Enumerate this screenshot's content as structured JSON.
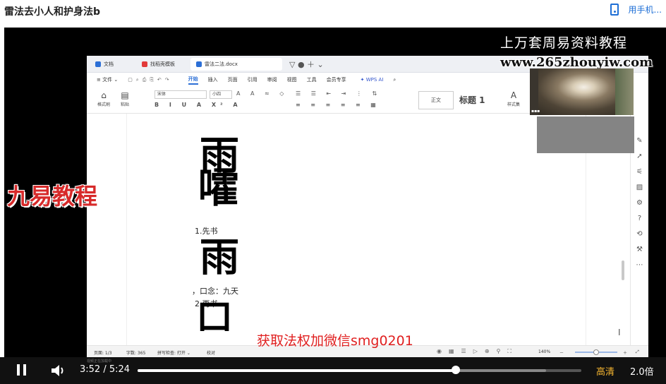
{
  "page": {
    "title": "雷法去小人和护身法b",
    "mobile_link": "用手机..."
  },
  "watermarks": {
    "top": "上万套周易资料教程",
    "url": "www.265zhouyiw.com",
    "left": "九易教程",
    "banner": "获取法权加微信smg0201"
  },
  "wps": {
    "tabs": [
      {
        "label": "文档",
        "icon_color": "#2c6fd6"
      },
      {
        "label": "找稻壳模板",
        "icon_color": "#e23a3a"
      },
      {
        "label": "雷法二法.docx",
        "icon_color": "#2c6fd6"
      }
    ],
    "tab_extra": "▽ ● ＋ ⌄",
    "menu_label": "≡ 文件 ⌄",
    "ribbon_tabs": [
      "开始",
      "插入",
      "页面",
      "引用",
      "审阅",
      "视图",
      "工具",
      "会员专享"
    ],
    "ribbon_active": "开始",
    "wps_ai": "WPS AI",
    "toolbar": {
      "format_painter": "格式刷",
      "paste": "粘贴",
      "font": "宋体",
      "size": "小四",
      "style_normal": "正文",
      "style_heading": "标题 1",
      "style_set": "样式集"
    },
    "document": {
      "glyph1": "雨",
      "glyph2": "嚯",
      "step1": "1.先书",
      "glyph3": "雨",
      "note": "，口念：九天",
      "step2": "2.再书",
      "glyph4": "口"
    },
    "status": {
      "page": "页面: 1/3",
      "words": "字数: 365",
      "spell": "拼写检查: 打开 ⌄",
      "proof": "校对",
      "zoom": "140%"
    }
  },
  "player": {
    "current_time": "3:52",
    "separator": "/",
    "duration": "5:24",
    "progress": 0.717,
    "buffered": 0.92,
    "quality": "高清",
    "speed": "2.0倍",
    "mini_label": "视频正在加载中"
  }
}
